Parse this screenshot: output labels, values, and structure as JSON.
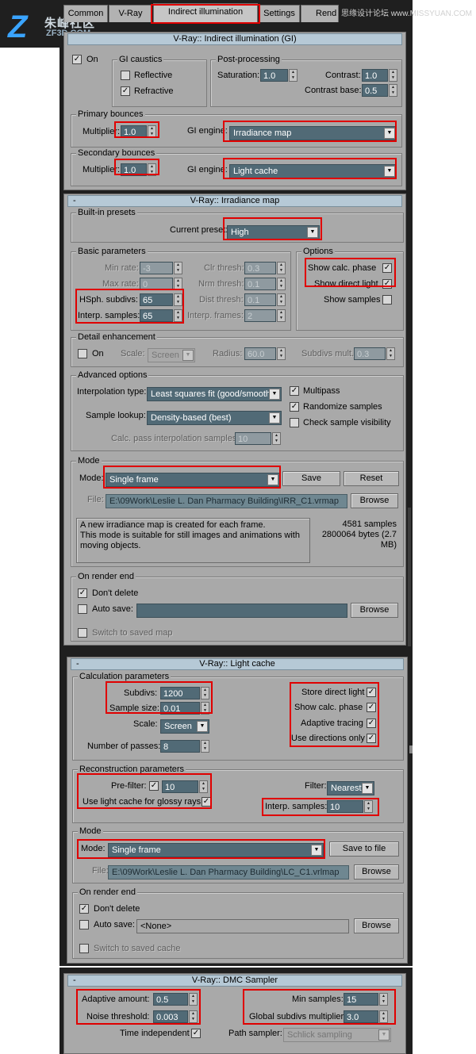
{
  "watermark_left": {
    "glyph": "Z",
    "name": "朱峰社区",
    "site": "ZF3D.COM"
  },
  "watermark_right": "思缘设计论坛 www.MISSYUAN.COM",
  "tabs": [
    "Common",
    "V-Ray",
    "Indirect illumination",
    "Settings",
    "Rend"
  ],
  "gi": {
    "title": "V-Ray:: Indirect illumination (GI)",
    "on_label": "On",
    "caustics_title": "GI caustics",
    "reflective": "Reflective",
    "refractive": "Refractive",
    "post_title": "Post-processing",
    "saturation_label": "Saturation:",
    "saturation": "1.0",
    "contrast_label": "Contrast:",
    "contrast": "1.0",
    "contrast_base_label": "Contrast base:",
    "contrast_base": "0.5",
    "primary_title": "Primary bounces",
    "primary_mult_label": "Multiplier:",
    "primary_mult": "1.0",
    "gi_engine_label": "GI engine:",
    "primary_engine": "Irradiance map",
    "secondary_title": "Secondary bounces",
    "secondary_mult_label": "Multiplier:",
    "secondary_mult": "1.0",
    "gi_engine_label2": "GI engine:",
    "secondary_engine": "Light cache"
  },
  "irr": {
    "minus": "-",
    "title": "V-Ray:: Irradiance map",
    "presets_title": "Built-in presets",
    "current_preset_label": "Current preset:",
    "current_preset": "High",
    "basic_title": "Basic parameters",
    "min_rate_label": "Min rate:",
    "min_rate": "-3",
    "max_rate_label": "Max rate:",
    "max_rate": "0",
    "hsph_label": "HSph. subdivs:",
    "hsph": "65",
    "interp_label": "Interp. samples:",
    "interp": "65",
    "clr_label": "Clr thresh:",
    "clr": "0.3",
    "nrm_label": "Nrm thresh:",
    "nrm": "0.1",
    "dist_label": "Dist thresh:",
    "dist": "0.1",
    "frames_label": "Interp. frames:",
    "frames": "2",
    "options_title": "Options",
    "show_calc": "Show calc. phase",
    "show_direct": "Show direct light",
    "show_samples": "Show samples",
    "detail_title": "Detail enhancement",
    "detail_on": "On",
    "scale_label": "Scale:",
    "scale": "Screen",
    "radius_label": "Radius:",
    "radius": "60.0",
    "subdivs_mult_label": "Subdivs mult.",
    "subdivs_mult": "0.3",
    "adv_title": "Advanced options",
    "interp_type_label": "Interpolation type:",
    "interp_type": "Least squares fit (good/smooth)",
    "lookup_label": "Sample lookup:",
    "lookup": "Density-based (best)",
    "calc_pass_label": "Calc. pass interpolation samples:",
    "calc_pass": "10",
    "multipass": "Multipass",
    "randomize": "Randomize samples",
    "check_vis": "Check sample visibility",
    "mode_title": "Mode",
    "mode_label": "Mode:",
    "mode": "Single frame",
    "save": "Save",
    "reset": "Reset",
    "file_label": "File:",
    "file": "E:\\09Work\\Leslie L. Dan Pharmacy Building\\IRR_C1.vrmap",
    "browse": "Browse",
    "desc_lines": [
      "A new irradiance map is created for each frame.",
      "This mode is suitable for still images and animations with",
      "moving objects."
    ],
    "samples": "4581 samples",
    "bytes_line1": "2800064 bytes (2.7",
    "bytes_line2": "MB)",
    "end_title": "On render end",
    "dont_delete": "Don't delete",
    "auto_save": "Auto save:",
    "browse2": "Browse",
    "switch": "Switch to saved map"
  },
  "lc": {
    "minus": "-",
    "title": "V-Ray:: Light cache",
    "calc_title": "Calculation parameters",
    "subdivs_label": "Subdivs:",
    "subdivs": "1200",
    "sample_size_label": "Sample size:",
    "sample_size": "0.01",
    "scale_label": "Scale:",
    "scale": "Screen",
    "passes_label": "Number of passes:",
    "passes": "8",
    "store_direct": "Store direct light",
    "show_calc": "Show calc. phase",
    "adaptive": "Adaptive tracing",
    "use_dirs": "Use directions only",
    "recon_title": "Reconstruction parameters",
    "prefilter_label": "Pre-filter:",
    "prefilter": "10",
    "glossy": "Use light cache for glossy rays",
    "filter_label": "Filter:",
    "filter": "Nearest",
    "interp_label": "Interp. samples:",
    "interp": "10",
    "mode_title": "Mode",
    "mode_label": "Mode:",
    "mode": "Single frame",
    "save_to_file": "Save to file",
    "file_label": "File:",
    "file": "E:\\09Work\\Leslie L. Dan Pharmacy Building\\LC_C1.vrlmap",
    "browse": "Browse",
    "end_title": "On render end",
    "dont_delete": "Don't delete",
    "auto_save": "Auto save:",
    "auto_save_value": "<None>",
    "browse2": "Browse",
    "switch": "Switch to saved cache"
  },
  "dmc": {
    "minus": "-",
    "title": "V-Ray:: DMC Sampler",
    "adaptive_label": "Adaptive amount:",
    "adaptive": "0.5",
    "noise_label": "Noise threshold:",
    "noise": "0.003",
    "time_indep": "Time independent",
    "min_samples_label": "Min samples:",
    "min_samples": "15",
    "global_label": "Global subdivs multiplier:",
    "global": "3.0",
    "path_label": "Path sampler:",
    "path": "Schlick sampling"
  }
}
